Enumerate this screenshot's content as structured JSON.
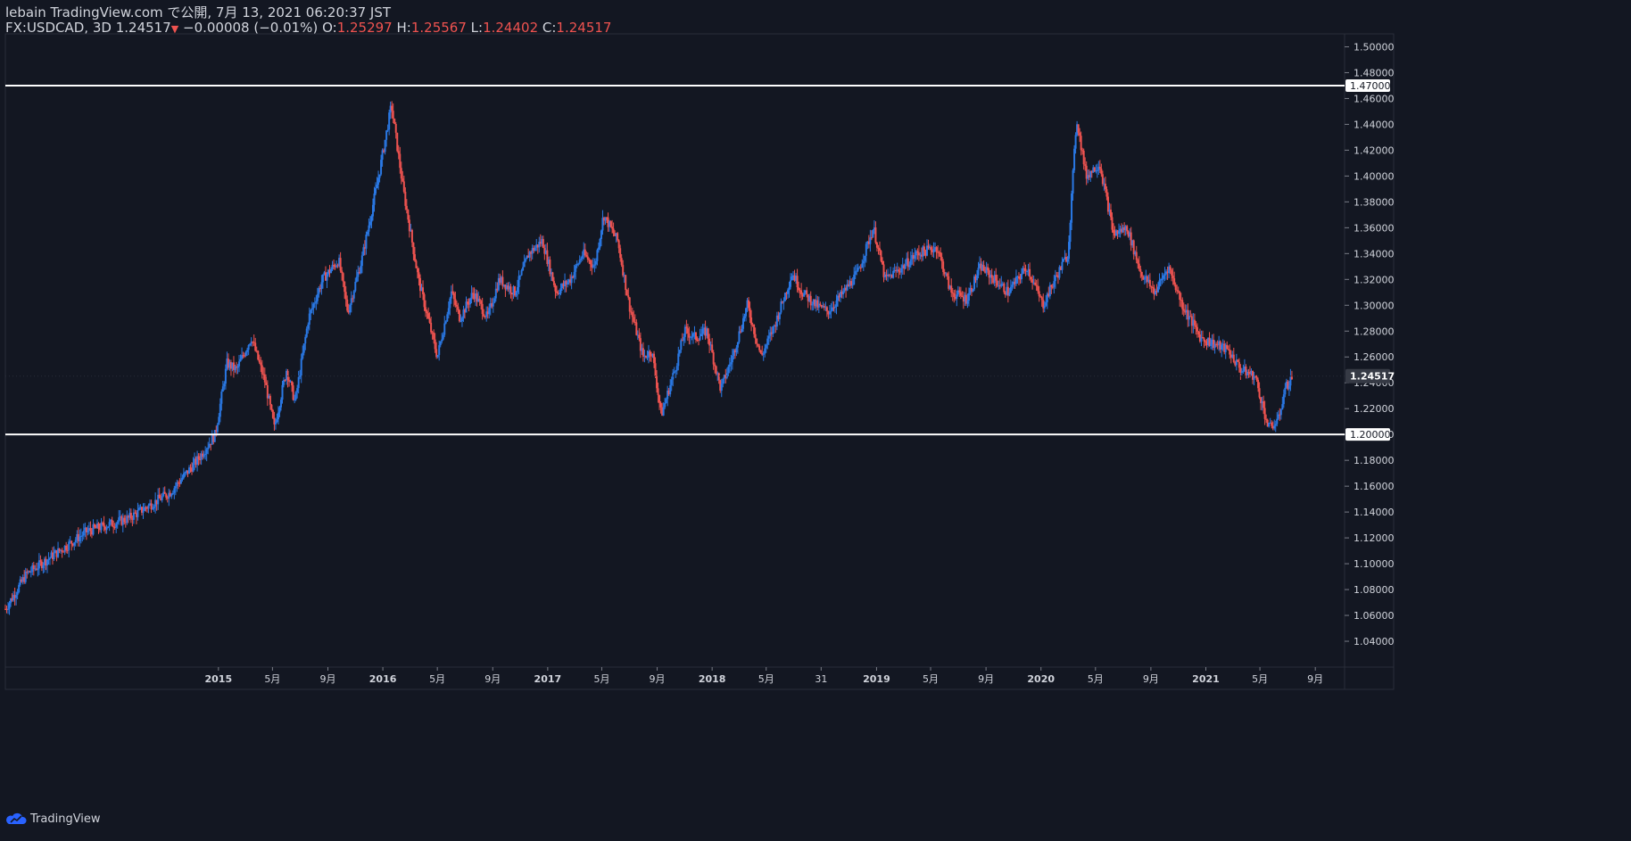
{
  "header": {
    "line1": "lebain TradingView.com で公開, 7月 13, 2021 06:20:37 JST",
    "symbol_interval": "FX:USDCAD, 3D",
    "last": "1.24517",
    "arrow": "▼",
    "change": "−0.00008 (−0.01%)",
    "o_label": "O:",
    "o_val": "1.25297",
    "h_label": "H:",
    "h_val": "1.25567",
    "l_label": "L:",
    "l_val": "1.24402",
    "c_label": "C:",
    "c_val": "1.24517"
  },
  "footer": {
    "brand": "TradingView"
  },
  "colors": {
    "up": "#2a78e4",
    "down": "#ef5350",
    "bg": "#131722",
    "grid": "#2a2e39",
    "text": "#d1d4dc",
    "hline": "#ffffff"
  },
  "chart_data": {
    "type": "candlestick",
    "symbol": "FX:USDCAD",
    "interval": "3D",
    "ylim": [
      1.02,
      1.51
    ],
    "y_ticks": [
      1.04,
      1.06,
      1.08,
      1.1,
      1.12,
      1.14,
      1.16,
      1.18,
      1.2,
      1.22,
      1.24,
      1.26,
      1.28,
      1.3,
      1.32,
      1.34,
      1.36,
      1.38,
      1.4,
      1.42,
      1.44,
      1.46,
      1.48,
      1.5
    ],
    "y_tick_labels": [
      "1.04000",
      "1.06000",
      "1.08000",
      "1.10000",
      "1.12000",
      "1.14000",
      "1.16000",
      "1.18000",
      "1.20000",
      "1.22000",
      "1.24000",
      "1.26000",
      "1.28000",
      "1.30000",
      "1.32000",
      "1.34000",
      "1.36000",
      "1.38000",
      "1.40000",
      "1.42000",
      "1.44000",
      "1.46000",
      "1.48000",
      "1.50000"
    ],
    "x_ticks": [
      {
        "label": "2015",
        "date": "2015-01-01"
      },
      {
        "label": "5月",
        "date": "2015-05-01"
      },
      {
        "label": "9月",
        "date": "2015-09-01"
      },
      {
        "label": "2016",
        "date": "2016-01-01"
      },
      {
        "label": "5月",
        "date": "2016-05-01"
      },
      {
        "label": "9月",
        "date": "2016-09-01"
      },
      {
        "label": "2017",
        "date": "2017-01-01"
      },
      {
        "label": "5月",
        "date": "2017-05-01"
      },
      {
        "label": "9月",
        "date": "2017-09-01"
      },
      {
        "label": "2018",
        "date": "2018-01-01"
      },
      {
        "label": "5月",
        "date": "2018-05-01"
      },
      {
        "label": "31",
        "date": "2018-08-31"
      },
      {
        "label": "2019",
        "date": "2019-01-01"
      },
      {
        "label": "5月",
        "date": "2019-05-01"
      },
      {
        "label": "9月",
        "date": "2019-09-01"
      },
      {
        "label": "2020",
        "date": "2020-01-01"
      },
      {
        "label": "5月",
        "date": "2020-05-01"
      },
      {
        "label": "9月",
        "date": "2020-09-01"
      },
      {
        "label": "2021",
        "date": "2021-01-01"
      },
      {
        "label": "5月",
        "date": "2021-05-01"
      },
      {
        "label": "9月",
        "date": "2021-09-01"
      }
    ],
    "x_range": [
      "2013-09-15",
      "2021-11-05"
    ],
    "horizontal_lines": [
      {
        "value": 1.47,
        "label": "1.47000"
      },
      {
        "value": 1.2,
        "label": "1.20000"
      }
    ],
    "last_price": {
      "value": 1.24517,
      "label": "1.24517"
    },
    "price_path": [
      [
        "2013-09-15",
        1.065
      ],
      [
        "2013-11-01",
        1.092
      ],
      [
        "2014-01-01",
        1.107
      ],
      [
        "2014-03-15",
        1.125
      ],
      [
        "2014-06-15",
        1.135
      ],
      [
        "2014-09-15",
        1.155
      ],
      [
        "2014-11-15",
        1.18
      ],
      [
        "2014-12-25",
        1.2
      ],
      [
        "2015-01-20",
        1.255
      ],
      [
        "2015-02-10",
        1.25
      ],
      [
        "2015-03-15",
        1.275
      ],
      [
        "2015-04-15",
        1.24
      ],
      [
        "2015-05-05",
        1.205
      ],
      [
        "2015-06-01",
        1.25
      ],
      [
        "2015-06-20",
        1.225
      ],
      [
        "2015-07-20",
        1.29
      ],
      [
        "2015-08-20",
        1.32
      ],
      [
        "2015-09-25",
        1.335
      ],
      [
        "2015-10-15",
        1.295
      ],
      [
        "2015-11-15",
        1.335
      ],
      [
        "2015-12-20",
        1.395
      ],
      [
        "2016-01-20",
        1.455
      ],
      [
        "2016-02-15",
        1.39
      ],
      [
        "2016-03-20",
        1.32
      ],
      [
        "2016-05-01",
        1.26
      ],
      [
        "2016-06-01",
        1.31
      ],
      [
        "2016-06-20",
        1.29
      ],
      [
        "2016-07-20",
        1.31
      ],
      [
        "2016-08-20",
        1.29
      ],
      [
        "2016-09-15",
        1.32
      ],
      [
        "2016-10-20",
        1.31
      ],
      [
        "2016-11-20",
        1.34
      ],
      [
        "2016-12-20",
        1.35
      ],
      [
        "2017-01-20",
        1.31
      ],
      [
        "2017-02-20",
        1.32
      ],
      [
        "2017-03-20",
        1.34
      ],
      [
        "2017-04-15",
        1.33
      ],
      [
        "2017-05-05",
        1.37
      ],
      [
        "2017-06-05",
        1.35
      ],
      [
        "2017-07-01",
        1.3
      ],
      [
        "2017-08-01",
        1.26
      ],
      [
        "2017-08-20",
        1.265
      ],
      [
        "2017-09-10",
        1.215
      ],
      [
        "2017-10-10",
        1.25
      ],
      [
        "2017-11-01",
        1.28
      ],
      [
        "2017-11-25",
        1.275
      ],
      [
        "2017-12-20",
        1.28
      ],
      [
        "2018-01-20",
        1.235
      ],
      [
        "2018-02-15",
        1.26
      ],
      [
        "2018-03-20",
        1.3
      ],
      [
        "2018-04-20",
        1.26
      ],
      [
        "2018-05-20",
        1.285
      ],
      [
        "2018-06-28",
        1.325
      ],
      [
        "2018-07-20",
        1.31
      ],
      [
        "2018-08-20",
        1.3
      ],
      [
        "2018-09-15",
        1.295
      ],
      [
        "2018-10-20",
        1.31
      ],
      [
        "2018-11-20",
        1.325
      ],
      [
        "2018-12-25",
        1.36
      ],
      [
        "2019-01-20",
        1.32
      ],
      [
        "2019-03-01",
        1.33
      ],
      [
        "2019-04-01",
        1.34
      ],
      [
        "2019-05-15",
        1.345
      ],
      [
        "2019-06-15",
        1.31
      ],
      [
        "2019-07-20",
        1.305
      ],
      [
        "2019-08-20",
        1.33
      ],
      [
        "2019-09-20",
        1.32
      ],
      [
        "2019-10-20",
        1.31
      ],
      [
        "2019-12-01",
        1.33
      ],
      [
        "2020-01-05",
        1.3
      ],
      [
        "2020-02-01",
        1.32
      ],
      [
        "2020-03-01",
        1.34
      ],
      [
        "2020-03-20",
        1.445
      ],
      [
        "2020-04-10",
        1.4
      ],
      [
        "2020-05-10",
        1.41
      ],
      [
        "2020-06-10",
        1.355
      ],
      [
        "2020-07-10",
        1.36
      ],
      [
        "2020-08-10",
        1.325
      ],
      [
        "2020-09-10",
        1.31
      ],
      [
        "2020-10-10",
        1.33
      ],
      [
        "2020-11-10",
        1.3
      ],
      [
        "2020-12-20",
        1.275
      ],
      [
        "2021-01-20",
        1.27
      ],
      [
        "2021-02-20",
        1.265
      ],
      [
        "2021-03-20",
        1.25
      ],
      [
        "2021-04-20",
        1.245
      ],
      [
        "2021-05-20",
        1.205
      ],
      [
        "2021-06-10",
        1.21
      ],
      [
        "2021-06-25",
        1.235
      ],
      [
        "2021-07-13",
        1.245
      ]
    ]
  }
}
